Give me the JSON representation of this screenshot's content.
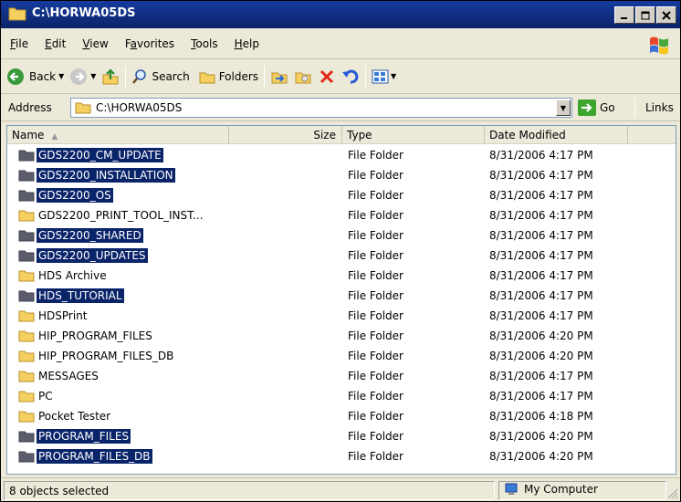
{
  "window": {
    "title": "C:\\HORWA05DS"
  },
  "menubar": {
    "items": [
      {
        "label": "File",
        "u": "F",
        "rest": "ile"
      },
      {
        "label": "Edit",
        "u": "E",
        "rest": "dit"
      },
      {
        "label": "View",
        "u": "V",
        "rest": "iew"
      },
      {
        "label": "Favorites",
        "u": "a",
        "pre": "F",
        "rest": "vorites"
      },
      {
        "label": "Tools",
        "u": "T",
        "rest": "ools"
      },
      {
        "label": "Help",
        "u": "H",
        "rest": "elp"
      }
    ]
  },
  "toolbar": {
    "back_label": "Back",
    "search_label": "Search",
    "folders_label": "Folders"
  },
  "address": {
    "label": "Address",
    "value": "C:\\HORWA05DS",
    "go_label": "Go",
    "links_label": "Links"
  },
  "columns": {
    "name": "Name",
    "size": "Size",
    "type": "Type",
    "date": "Date Modified"
  },
  "rows": [
    {
      "name": "GDS2200_CM_UPDATE",
      "type": "File Folder",
      "date": "8/31/2006 4:17 PM",
      "selected": true
    },
    {
      "name": "GDS2200_INSTALLATION",
      "type": "File Folder",
      "date": "8/31/2006 4:17 PM",
      "selected": true
    },
    {
      "name": "GDS2200_OS",
      "type": "File Folder",
      "date": "8/31/2006 4:17 PM",
      "selected": true
    },
    {
      "name": "GDS2200_PRINT_TOOL_INST...",
      "type": "File Folder",
      "date": "8/31/2006 4:17 PM",
      "selected": false
    },
    {
      "name": "GDS2200_SHARED",
      "type": "File Folder",
      "date": "8/31/2006 4:17 PM",
      "selected": true
    },
    {
      "name": "GDS2200_UPDATES",
      "type": "File Folder",
      "date": "8/31/2006 4:17 PM",
      "selected": true
    },
    {
      "name": "HDS Archive",
      "type": "File Folder",
      "date": "8/31/2006 4:17 PM",
      "selected": false
    },
    {
      "name": "HDS_TUTORIAL",
      "type": "File Folder",
      "date": "8/31/2006 4:17 PM",
      "selected": true
    },
    {
      "name": "HDSPrint",
      "type": "File Folder",
      "date": "8/31/2006 4:17 PM",
      "selected": false
    },
    {
      "name": "HIP_PROGRAM_FILES",
      "type": "File Folder",
      "date": "8/31/2006 4:20 PM",
      "selected": false
    },
    {
      "name": "HIP_PROGRAM_FILES_DB",
      "type": "File Folder",
      "date": "8/31/2006 4:20 PM",
      "selected": false
    },
    {
      "name": "MESSAGES",
      "type": "File Folder",
      "date": "8/31/2006 4:17 PM",
      "selected": false
    },
    {
      "name": "PC",
      "type": "File Folder",
      "date": "8/31/2006 4:17 PM",
      "selected": false
    },
    {
      "name": "Pocket Tester",
      "type": "File Folder",
      "date": "8/31/2006 4:18 PM",
      "selected": false
    },
    {
      "name": "PROGRAM_FILES",
      "type": "File Folder",
      "date": "8/31/2006 4:20 PM",
      "selected": true
    },
    {
      "name": "PROGRAM_FILES_DB",
      "type": "File Folder",
      "date": "8/31/2006 4:20 PM",
      "selected": true
    }
  ],
  "statusbar": {
    "selection_text": "8 objects selected",
    "location_text": "My Computer"
  },
  "colors": {
    "selection": "#0a246a",
    "titlebar": "#0a246a",
    "folder": "#f5d061"
  }
}
